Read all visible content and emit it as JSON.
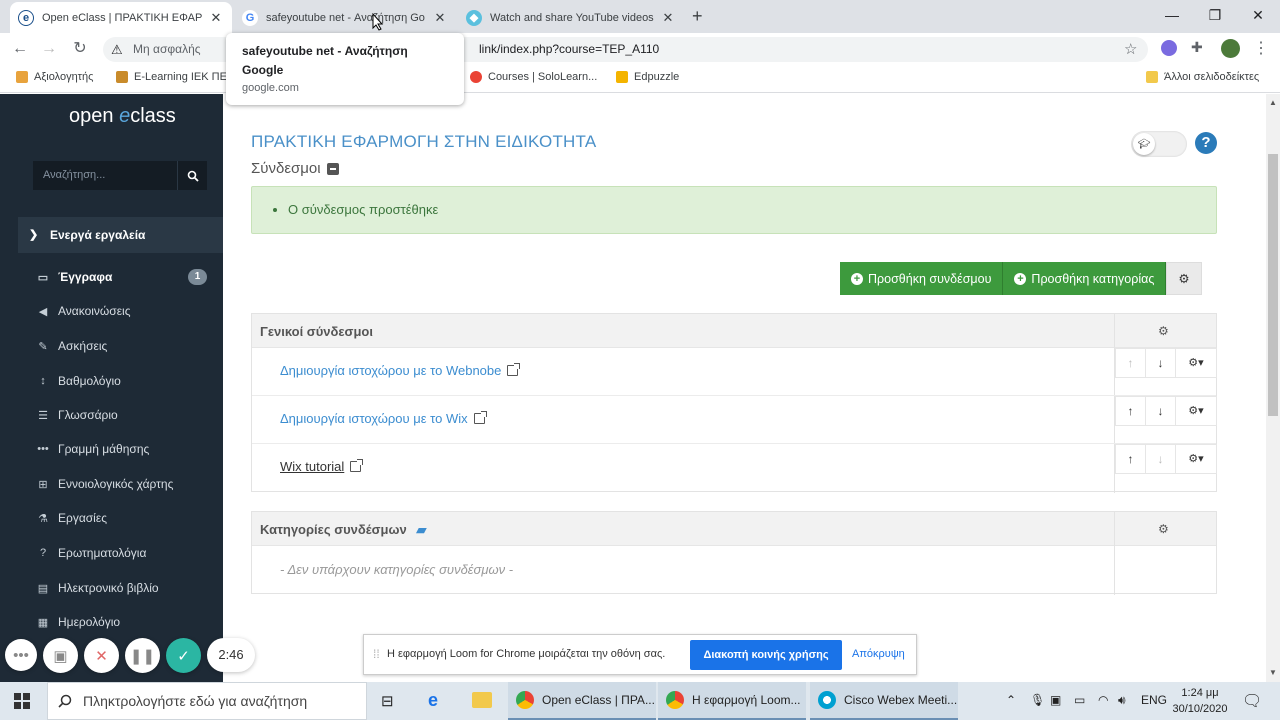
{
  "browser": {
    "tabs": [
      {
        "title": "Open eClass | ΠΡΑΚΤΙΚΗ ΕΦΑΡΜ",
        "active": true
      },
      {
        "title": "safeyoutube net - Αναζήτηση Go",
        "active": false
      },
      {
        "title": "Watch and share YouTube videos",
        "active": false
      }
    ],
    "new_tab_label": "+",
    "address": {
      "security_label": "Μη ασφαλής",
      "url_visible": "link/index.php?course=TEP_A110"
    },
    "bookmarks": [
      {
        "label": "Αξιολογητής"
      },
      {
        "label": "E-Learning ΙΕΚ ΠΕ"
      },
      {
        "label": "Courses | SoloLearn..."
      },
      {
        "label": "Edpuzzle"
      }
    ],
    "other_bookmarks": "Άλλοι σελιδοδείκτες",
    "tooltip": {
      "title": "safeyoutube net - Αναζήτηση Google",
      "domain": "google.com"
    }
  },
  "sidebar": {
    "logo_prefix": "open ",
    "logo_e": "e",
    "logo_suffix": "class",
    "search_placeholder": "Αναζήτηση...",
    "section_header": "Ενεργά εργαλεία",
    "items": [
      {
        "label": "Έγγραφα",
        "badge": "1"
      },
      {
        "label": "Ανακοινώσεις"
      },
      {
        "label": "Ασκήσεις"
      },
      {
        "label": "Βαθμολόγιο"
      },
      {
        "label": "Γλωσσάριο"
      },
      {
        "label": "Γραμμή μάθησης"
      },
      {
        "label": "Εννοιολογικός χάρτης"
      },
      {
        "label": "Εργασίες"
      },
      {
        "label": "Ερωτηματολόγια"
      },
      {
        "label": "Ηλεκτρονικό βιβλίο"
      },
      {
        "label": "Ημερολόγιο"
      }
    ]
  },
  "main": {
    "course_title": "ΠΡΑΚΤΙΚΗ ΕΦΑΡΜΟΓΗ ΣΤΗΝ ΕΙΔΙΚΟΤΗΤΑ",
    "section_title": "Σύνδεσμοι",
    "help_label": "?",
    "alert_message": "Ο σύνδεσμος προστέθηκε",
    "buttons": {
      "add_link": "Προσθήκη συνδέσμου",
      "add_category": "Προσθήκη κατηγορίας"
    },
    "general_links": {
      "title": "Γενικοί σύνδεσμοι",
      "rows": [
        {
          "label": "Δημιουργία ιστοχώρου με το Webnobe"
        },
        {
          "label": "Δημιουργία ιστοχώρου με το Wix"
        },
        {
          "label": "Wix tutorial"
        }
      ]
    },
    "categories": {
      "title": "Κατηγορίες συνδέσμων",
      "empty_text": "- Δεν υπάρχουν κατηγορίες συνδέσμων -"
    }
  },
  "loom": {
    "message": "Η εφαρμογή Loom for Chrome μοιράζεται την οθόνη σας.",
    "stop_label": "Διακοπή κοινής χρήσης",
    "hide_label": "Απόκρυψη"
  },
  "recording": {
    "time": "2:46"
  },
  "taskbar": {
    "search_placeholder": "Πληκτρολογήστε εδώ για αναζήτηση",
    "apps": [
      {
        "label": "Open eClass | ΠΡΑ..."
      },
      {
        "label": "Η εφαρμογή Loom..."
      },
      {
        "label": "Cisco Webex Meeti..."
      }
    ],
    "language": "ENG",
    "time": "1:24 μμ",
    "date": "30/10/2020"
  },
  "colors": {
    "sidebar_bg": "#1e2a36",
    "accent_blue": "#4a90c8",
    "success_green": "#3d9a3d",
    "alert_bg": "#dff0d8"
  }
}
